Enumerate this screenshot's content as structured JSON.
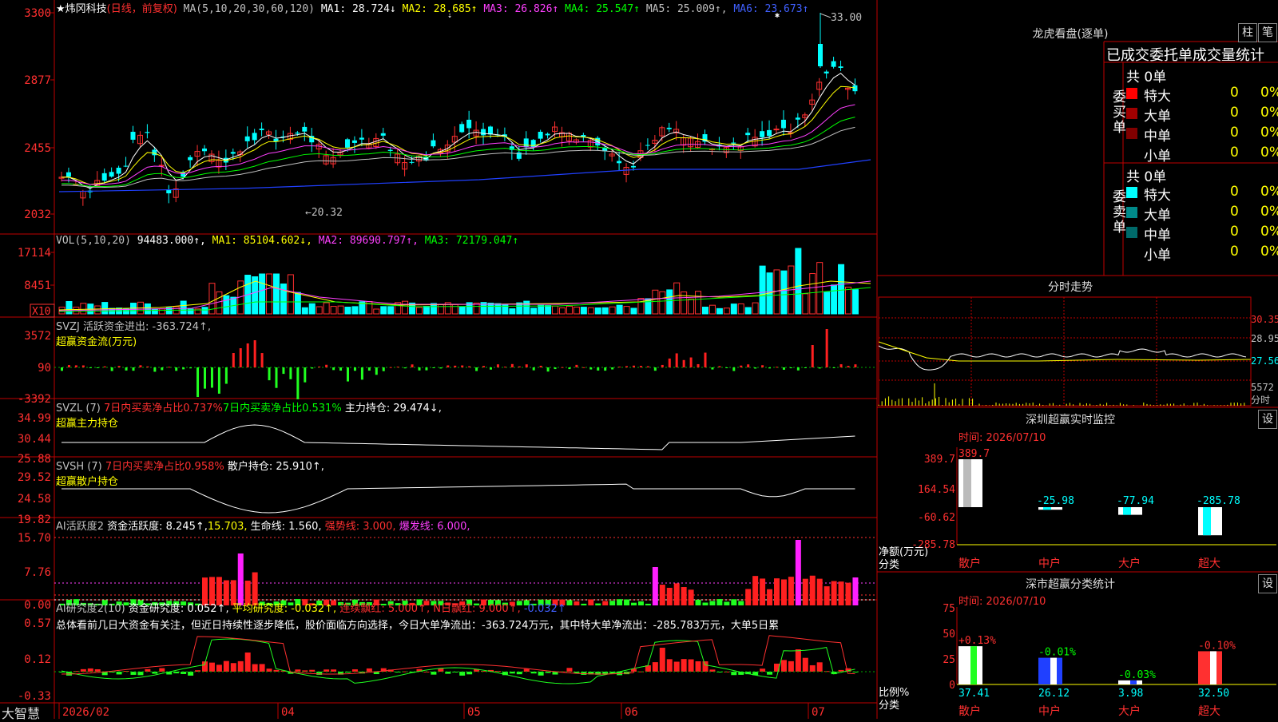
{
  "stock": {
    "title": "★炜冈科技",
    "period": "(日线，前复权)",
    "ma_header": {
      "label": "MA(5,10,20,30,60,120)",
      "items": [
        {
          "label": "MA1: 28.724↓",
          "color": "#ffffff"
        },
        {
          "label": "MA2: 28.685↑",
          "color": "#ffff00"
        },
        {
          "label": "MA3: 26.826↑",
          "color": "#ff40ff"
        },
        {
          "label": "MA4: 25.547↑",
          "color": "#00ff00"
        },
        {
          "label": "MA5: 25.009↑,",
          "color": "#c0c0c0"
        },
        {
          "label": "MA6: 23.673↑",
          "color": "#4060ff"
        }
      ]
    },
    "high_marker": "33.00",
    "low_marker": "←20.32"
  },
  "price_axis": [
    "3300",
    "2877",
    "2455",
    "2032"
  ],
  "vol": {
    "header": "VOL(5,10,20)",
    "value": "94483.000↑,",
    "items": [
      {
        "label": "MA1: 85104.602↓,",
        "color": "#ffff00"
      },
      {
        "label": "MA2: 89690.797↑,",
        "color": "#ff40ff"
      },
      {
        "label": "MA3: 72179.047↑",
        "color": "#00ff00"
      }
    ],
    "axis": [
      "17114",
      "8451"
    ],
    "unit": "X10"
  },
  "svzj": {
    "header": "SVZJ  活跃资金进出: -363.724↑,",
    "sub": "超赢资金流(万元)",
    "axis": [
      "3572",
      "90",
      "-3392"
    ]
  },
  "svzl": {
    "header_a": "SVZL (7)",
    "header_b": "7日内买卖净占比0.737%",
    "header_c": "7日内买卖净占比0.531%",
    "header_d": "主力持仓: 29.474↓,",
    "sub": "超赢主力持仓",
    "axis": [
      "34.99",
      "30.44",
      "25.88"
    ]
  },
  "svsh": {
    "header_a": "SVSH (7)",
    "header_b": "7日内买卖净占比0.958%",
    "header_c": "散户持仓: 25.910↑,",
    "sub": "超赢散户持仓",
    "axis": [
      "29.52",
      "24.58",
      "19.82"
    ]
  },
  "ai_active": {
    "header_a": "AI活跃度2",
    "header_b": "资金活跃度: 8.245↑,",
    "header_c": "15.703,",
    "header_d": "生命线: 1.560,",
    "header_e": "强势线: 3.000,",
    "header_f": "爆发线: 6.000,",
    "axis": [
      "15.70",
      "7.76",
      "0.00"
    ]
  },
  "ai_research": {
    "header_a": "AI研究度2(10)",
    "header_b": "资金研究度: 0.052↑,",
    "header_c": "平均研究度: -0.032↑,",
    "header_d": "连续飘红: 5.000↑,",
    "header_e": "N日飘红: 9.000↑,",
    "header_f": "-0.032↑",
    "summary": "总体看前几日大资金有关注，但近日持续性逐步降低，股价面临方向选择，今日大单净流出：-363.724万元，其中特大单净流出：-285.783万元，大单5日累",
    "axis": [
      "0.57",
      "0.12",
      "-0.33"
    ]
  },
  "xaxis": {
    "brand": "大智慧",
    "labels": [
      "2026/02",
      "04",
      "05",
      "06",
      "07"
    ]
  },
  "longhu": {
    "title": "龙虎看盘(逐单)",
    "btn_bar": "柱",
    "btn_line": "笔",
    "tabs_label": "已成交委托单成交量统计",
    "buy_label": "委买单",
    "sell_label": "委卖单",
    "buy_total": "共 0单",
    "sell_total": "共 0单",
    "buy_rows": [
      {
        "name": "特大",
        "count": "0",
        "pct": "0%",
        "color": "#ff0000"
      },
      {
        "name": "大单",
        "count": "0",
        "pct": "0%",
        "color": "#a00000"
      },
      {
        "name": "中单",
        "count": "0",
        "pct": "0%",
        "color": "#800000"
      },
      {
        "name": "小单",
        "count": "0",
        "pct": "0%",
        "color": "#000000"
      }
    ],
    "sell_rows": [
      {
        "name": "特大",
        "count": "0",
        "pct": "0%",
        "color": "#00ffff"
      },
      {
        "name": "大单",
        "count": "0",
        "pct": "0%",
        "color": "#008a8a"
      },
      {
        "name": "中单",
        "count": "0",
        "pct": "0%",
        "color": "#006a6a"
      },
      {
        "name": "小单",
        "count": "0",
        "pct": "0%",
        "color": "#000000"
      }
    ]
  },
  "intraday": {
    "title": "分时走势",
    "axis": [
      "30.35",
      "28.95",
      "27.56"
    ],
    "vol_axis": "5572",
    "unit": "分时"
  },
  "sz_monitor": {
    "title": "深圳超赢实时监控",
    "btn": "设",
    "time_label": "时间: 2026/07/10",
    "axis": [
      "389.7",
      "164.54",
      "-60.62",
      "-285.78"
    ],
    "y_label_a": "净额(万元)",
    "y_label_b": "分类",
    "categories": [
      "散户",
      "中户",
      "大户",
      "超大"
    ],
    "value_labels": [
      "389.7",
      "-25.98",
      "-77.94",
      "-285.78"
    ]
  },
  "sz_stats": {
    "title": "深市超赢分类统计",
    "btn": "设",
    "time_label": "时间: 2026/07/10",
    "axis": [
      "75",
      "50",
      "25",
      "0"
    ],
    "y_label_a": "比例%",
    "y_label_b": "分类",
    "categories": [
      "散户",
      "中户",
      "大户",
      "超大"
    ],
    "change_labels": [
      "+0.13%",
      "-0.01%",
      "-0.03%",
      "-0.10%"
    ],
    "value_labels": [
      "37.41",
      "26.12",
      "3.98",
      "32.50"
    ]
  },
  "chart_data": {
    "type": "bar",
    "title": "深圳超赢实时监控",
    "categories": [
      "散户",
      "中户",
      "大户",
      "超大"
    ],
    "values": [
      389.7,
      -25.98,
      -77.94,
      -285.78
    ],
    "ylabel": "净额(万元)",
    "ylim": [
      -285.78,
      389.7
    ]
  },
  "chart_data_2": {
    "type": "bar",
    "title": "深市超赢分类统计",
    "categories": [
      "散户",
      "中户",
      "大户",
      "超大"
    ],
    "values": [
      37.41,
      26.12,
      3.98,
      32.5
    ],
    "ylabel": "比例%",
    "ylim": [
      0,
      75
    ]
  }
}
